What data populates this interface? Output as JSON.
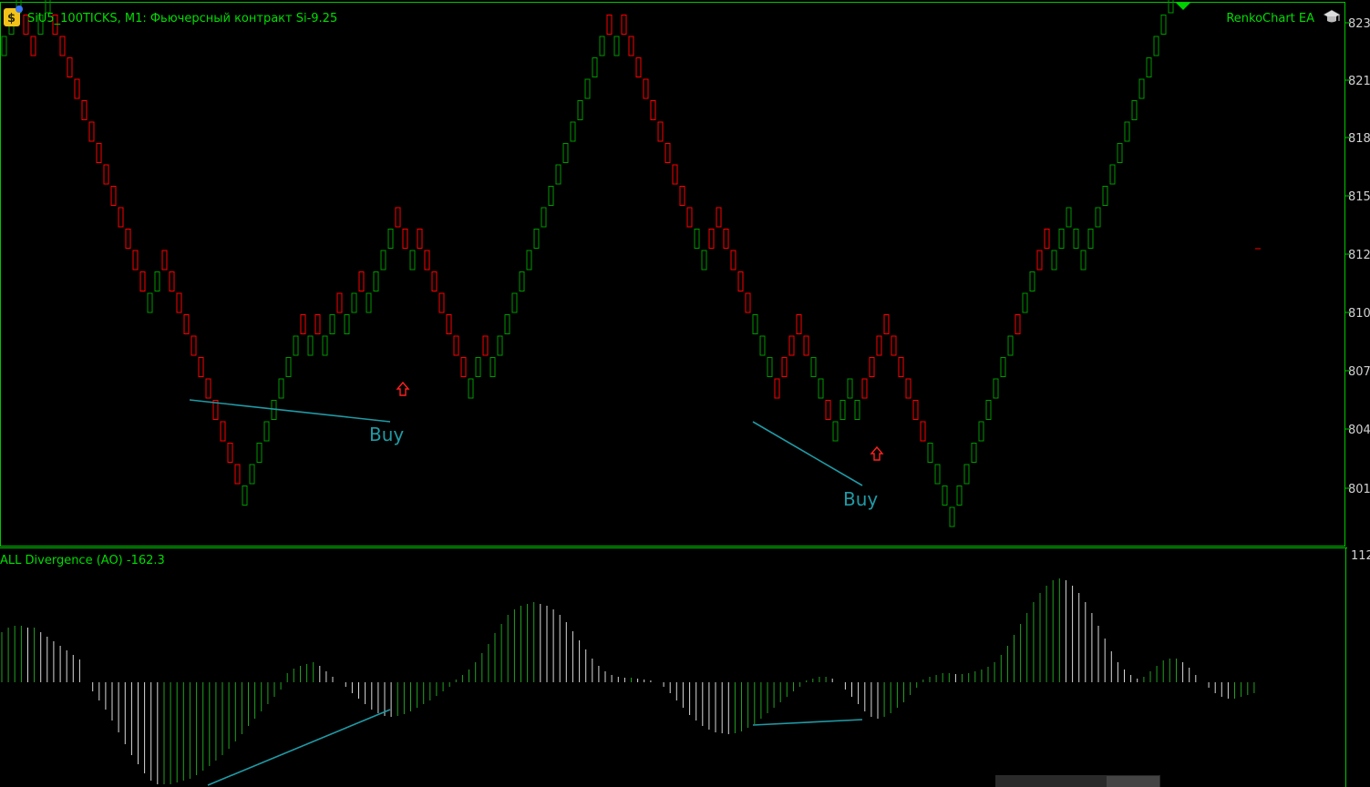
{
  "header": {
    "symbol_title": "SiU5_100TICKS, M1:  Фьючерсный контракт Si-9.25",
    "ea_label": "RenkoChart EA"
  },
  "indicator": {
    "title": "ALL Divergence (AO) -162.3",
    "top_tick": "112"
  },
  "signals": [
    {
      "label": "Buy"
    },
    {
      "label": "Buy"
    }
  ],
  "colors": {
    "background": "#000000",
    "frame": "#00c800",
    "bull": "#009900",
    "bear": "#ff0000",
    "divergence_line": "#1f9aa5",
    "hist_up": "#22a022",
    "hist_down": "#d8d8d8",
    "text": "#00dd00",
    "signal_text": "#1f9aa5",
    "arrow": "#ff2020"
  },
  "icons": {
    "logo": "expert-advisor-icon",
    "graduation": "graduation-cap-icon",
    "shift_marker": "triangle-down-icon",
    "signal_arrow": "up-arrow-icon"
  },
  "chart_data": [
    {
      "type": "renko",
      "price_axis_labels": [
        "823",
        "821",
        "818",
        "815",
        "812",
        "810",
        "807",
        "804",
        "801"
      ],
      "brick_size_ticks": 100,
      "brick_directions": "UUUDDUUDDDDDDDDDDDDDUUDDDDDDDDDDDUUUUUUUUDUDUUDUUDUUUUDDUDDDDDDDUUDUUUUUUUUUUUUUUUUDUDDDDDDDDDDUUDDDDDDUUUDDDDDUUDUUUUDDDDDDDDDUUUUUUUUUUUUDUUDDUUUUUUUUUUUUUUUUUUUUUUDDDDDDDDDUUUUUUDUDDDDUUD",
      "brick_path_units": [
        0,
        1,
        2,
        1,
        0,
        1,
        2,
        1,
        0,
        -1,
        -2,
        -3,
        -4,
        -5,
        -6,
        -7,
        -8,
        -9,
        -10,
        -11,
        -12,
        -11,
        -10,
        -11,
        -12,
        -13,
        -14,
        -15,
        -16,
        -17,
        -18,
        -19,
        -20,
        -21,
        -20,
        -19,
        -18,
        -17,
        -16,
        -15,
        -14,
        -13,
        -14,
        -13,
        -14,
        -13,
        -12,
        -13,
        -12,
        -11,
        -12,
        -11,
        -10,
        -9,
        -8,
        -9,
        -10,
        -9,
        -10,
        -11,
        -12,
        -13,
        -14,
        -15,
        -16,
        -15,
        -14,
        -15,
        -14,
        -13,
        -12,
        -11,
        -10,
        -9,
        -8,
        -7,
        -6,
        -5,
        -4,
        -3,
        -2,
        -1,
        0,
        1,
        0,
        1,
        0,
        -1,
        -2,
        -3,
        -4,
        -5,
        -6,
        -7,
        -8,
        -9,
        -10,
        -9,
        -8,
        -9,
        -10,
        -11,
        -12,
        -13,
        -14,
        -15,
        -16,
        -15,
        -14,
        -13,
        -14,
        -15,
        -16,
        -17,
        -18,
        -17,
        -16,
        -17,
        -16,
        -15,
        -14,
        -13,
        -14,
        -15,
        -16,
        -17,
        -18,
        -19,
        -20,
        -21,
        -22,
        -21,
        -20,
        -19,
        -18,
        -17,
        -16,
        -15,
        -14,
        -13,
        -12,
        -11,
        -10,
        -9,
        -10,
        -9,
        -8,
        -9,
        -10,
        -9,
        -8,
        -7,
        -6,
        -5,
        -4,
        -3,
        -2,
        -1,
        0,
        1,
        2,
        3,
        4,
        5,
        6,
        7,
        8,
        9,
        10,
        11,
        12,
        13,
        12,
        11,
        10,
        9,
        8,
        7,
        6,
        5,
        4,
        3,
        4,
        5,
        6,
        7,
        8,
        9,
        8,
        9,
        8,
        7,
        6,
        5,
        6,
        7,
        6
      ],
      "price_range": [
        800,
        824
      ]
    },
    {
      "type": "histogram",
      "series_name": "ALL Divergence (AO)",
      "last_value": -162.3,
      "ylim_top": 112,
      "values": [
        55,
        60,
        62,
        62,
        60,
        60,
        55,
        50,
        45,
        40,
        35,
        30,
        25,
        0,
        -10,
        -20,
        -30,
        -42,
        -55,
        -68,
        -80,
        -90,
        -100,
        -108,
        -112,
        -112,
        -112,
        -110,
        -108,
        -106,
        -102,
        -97,
        -92,
        -86,
        -80,
        -73,
        -65,
        -57,
        -48,
        -40,
        -32,
        -24,
        -16,
        -8,
        10,
        15,
        18,
        20,
        22,
        18,
        12,
        6,
        0,
        -5,
        -12,
        -18,
        -24,
        -30,
        -34,
        -37,
        -38,
        -37,
        -35,
        -32,
        -28,
        -24,
        -20,
        -15,
        -10,
        -5,
        3,
        8,
        14,
        22,
        32,
        42,
        54,
        64,
        74,
        80,
        84,
        86,
        88,
        86,
        84,
        80,
        74,
        66,
        56,
        46,
        36,
        26,
        18,
        12,
        8,
        6,
        5,
        5,
        4,
        3,
        2,
        0,
        -5,
        -12,
        -20,
        -28,
        -36,
        -42,
        -48,
        -52,
        -55,
        -56,
        -57,
        -56,
        -54,
        -50,
        -46,
        -40,
        -34,
        -28,
        -22,
        -16,
        -10,
        -5,
        2,
        4,
        6,
        6,
        4,
        0,
        -8,
        -16,
        -24,
        -32,
        -38,
        -40,
        -38,
        -34,
        -28,
        -22,
        -14,
        -6,
        3,
        6,
        8,
        10,
        10,
        9,
        9,
        10,
        12,
        14,
        17,
        22,
        30,
        40,
        52,
        64,
        76,
        88,
        98,
        106,
        112,
        114,
        112,
        106,
        98,
        88,
        76,
        62,
        48,
        34,
        22,
        14,
        8,
        4,
        6,
        12,
        18,
        24,
        26,
        26,
        22,
        16,
        8,
        0,
        -6,
        -12,
        -16,
        -18,
        -18,
        -16,
        -14,
        -12
      ]
    }
  ]
}
